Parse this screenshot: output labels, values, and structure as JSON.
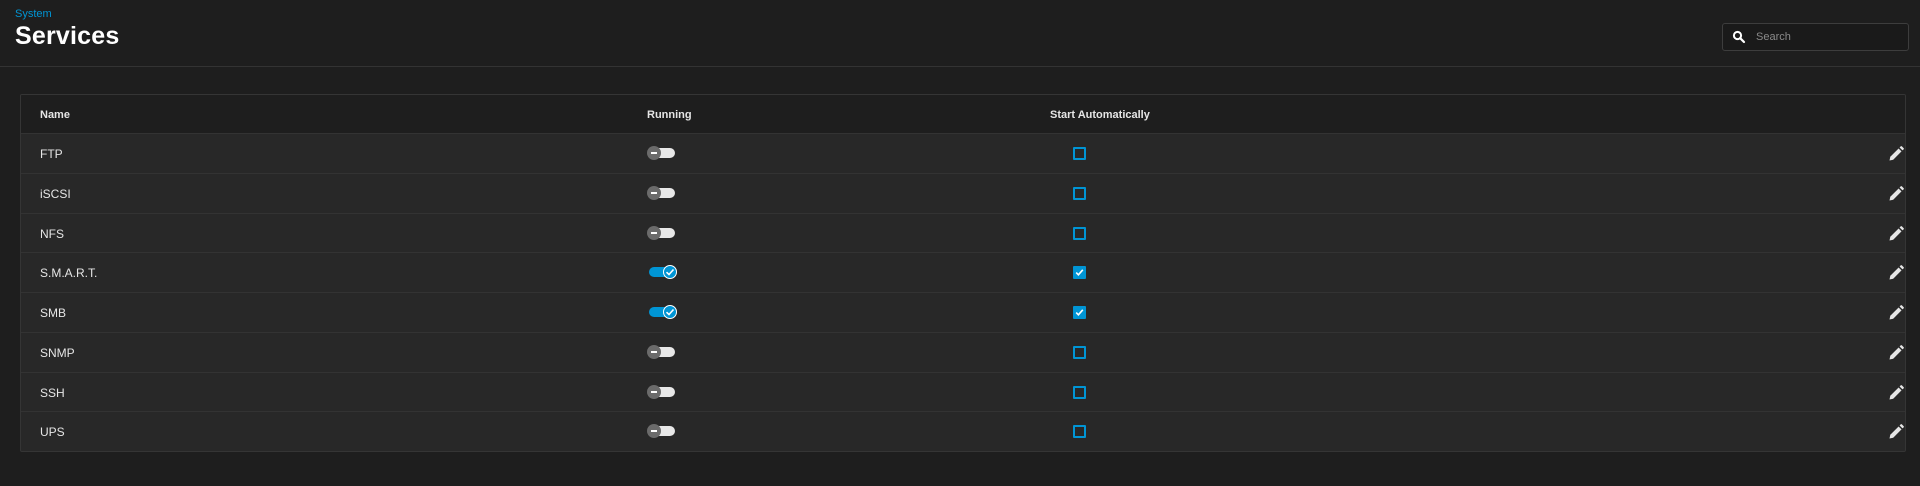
{
  "header": {
    "breadcrumb": "System",
    "title": "Services"
  },
  "search": {
    "placeholder": "Search",
    "value": ""
  },
  "table": {
    "columns": {
      "name": "Name",
      "running": "Running",
      "start_automatically": "Start Automatically"
    },
    "rows": [
      {
        "name": "FTP",
        "running": false,
        "start_automatically": false
      },
      {
        "name": "iSCSI",
        "running": false,
        "start_automatically": false
      },
      {
        "name": "NFS",
        "running": false,
        "start_automatically": false
      },
      {
        "name": "S.M.A.R.T.",
        "running": true,
        "start_automatically": true
      },
      {
        "name": "SMB",
        "running": true,
        "start_automatically": true
      },
      {
        "name": "SNMP",
        "running": false,
        "start_automatically": false
      },
      {
        "name": "SSH",
        "running": false,
        "start_automatically": false
      },
      {
        "name": "UPS",
        "running": false,
        "start_automatically": false
      }
    ]
  },
  "icons": {
    "search": "search-icon",
    "edit": "pencil-icon"
  },
  "colors": {
    "accent": "#0095d5",
    "background": "#1e1e1e",
    "card": "#282828"
  }
}
